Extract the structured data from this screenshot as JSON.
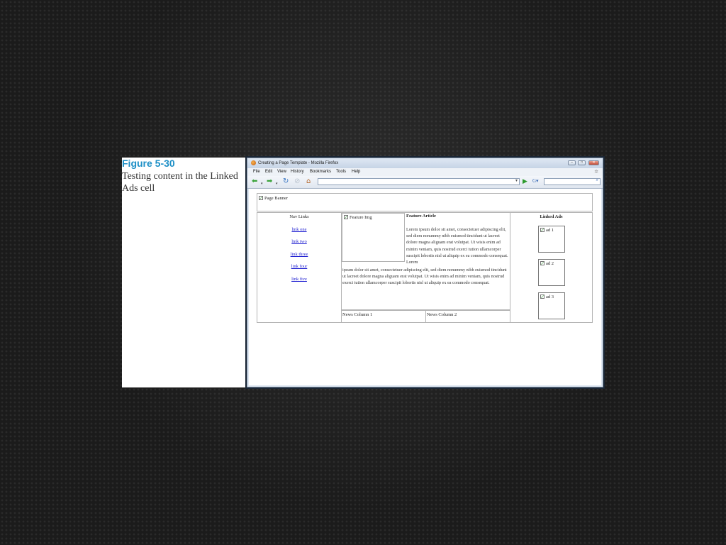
{
  "slide": {
    "figure_number": "Figure 5-30",
    "caption": "Testing content in the Linked Ads cell"
  },
  "browser": {
    "window_title": "Creating a Page Template - Mozilla Firefox",
    "window_controls": {
      "minimize": "–",
      "maximize": "□",
      "close": "✕"
    },
    "menu": [
      "File",
      "Edit",
      "View",
      "History",
      "Bookmarks",
      "Tools",
      "Help"
    ],
    "toolbar_icons": [
      "back-arrow-icon",
      "forward-arrow-icon",
      "reload-icon",
      "stop-icon",
      "home-icon"
    ],
    "url_value": "",
    "search_value": ""
  },
  "page": {
    "banner": "Page Banner",
    "nav_heading": "Nav Links",
    "nav_links": [
      "link one",
      "link two",
      "link three",
      "link four",
      "link five"
    ],
    "feature_img": "Feature Img",
    "feature_title": "Feature Article",
    "article_p1": "Lorem ipsum dolor sit amet, consectetuer adipiscing elit, sed diem nonummy nibh euismod tincidunt ut lacreet dolore magna aliguam erat volutpat. Ut wisis enim ad minim veniam, quis nostrud exerci tution ullamcorper suscipit lobortis nisl ut aliquip ex ea commodo consequat. Lorem",
    "article_p2": "ipsum dolor sit amet, consectetuer adipiscing elit, sed diem nonummy nibh euismod tincidunt ut lacreet dolore magna aliguam erat volutpat. Ut wisis enim ad minim veniam, quis nostrud exerci tution ullamcorper suscipit lobortis nisl ut aliquip ex ea commodo consequat.",
    "news_col_1": "News Column 1",
    "news_col_2": "News Column 2",
    "ads_heading": "Linked Ads",
    "ads": [
      "ad 1",
      "ad 2",
      "ad 3"
    ]
  }
}
